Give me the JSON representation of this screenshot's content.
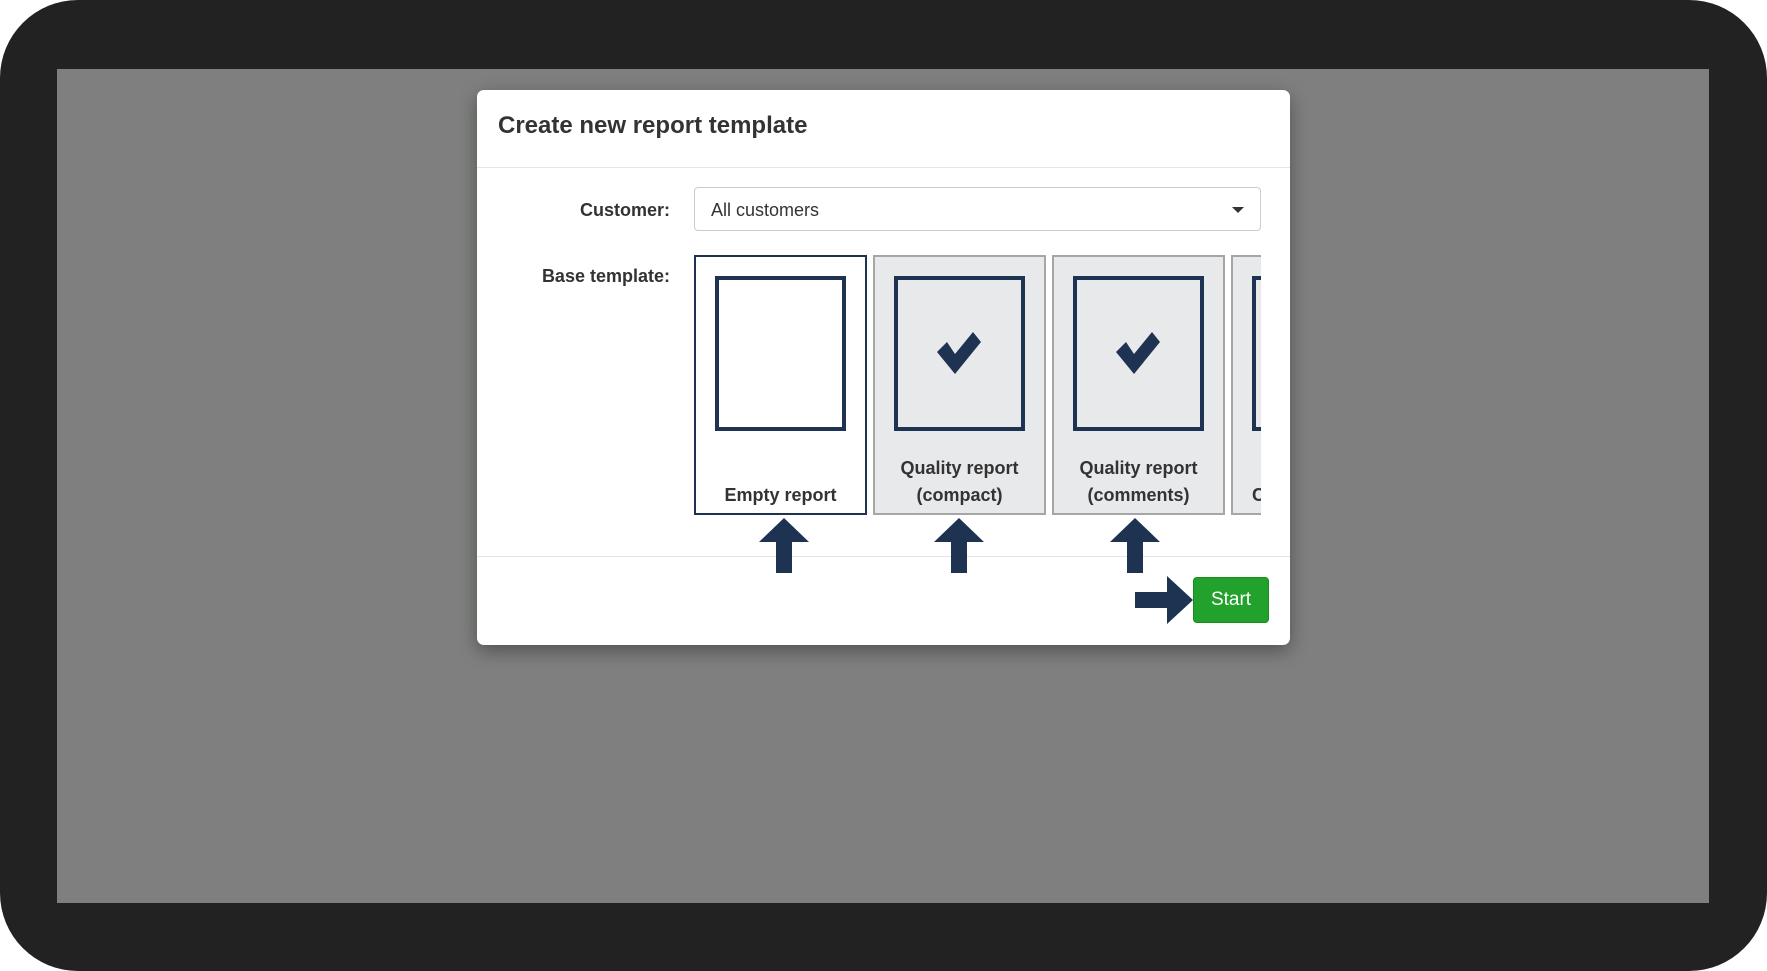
{
  "dialog": {
    "title": "Create new report template",
    "customer_label": "Customer:",
    "customer_value": "All customers",
    "base_template_label": "Base template:",
    "templates": [
      {
        "label": "Empty report",
        "selected": true,
        "icon": "blank-document-icon"
      },
      {
        "label": "Quality report\n(compact)",
        "selected": false,
        "icon": "checkmark-document-icon"
      },
      {
        "label": "Quality report\n(comments)",
        "selected": false,
        "icon": "checkmark-document-icon"
      },
      {
        "label": "C",
        "selected": false,
        "icon": "checkmark-document-icon"
      }
    ],
    "start_label": "Start"
  },
  "colors": {
    "accent_navy": "#1e3252",
    "start_green": "#22a22c",
    "overlay": "#7e7f7e"
  }
}
